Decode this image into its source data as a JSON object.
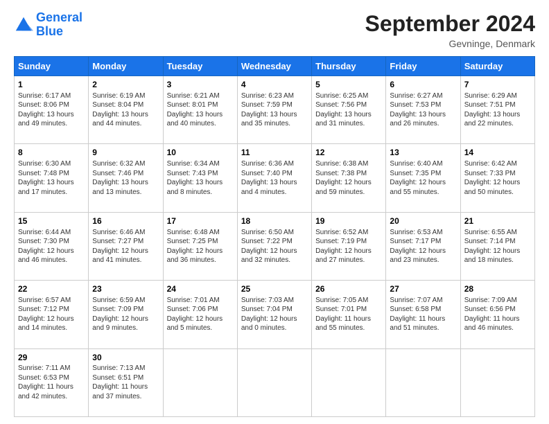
{
  "header": {
    "logo_line1": "General",
    "logo_line2": "Blue",
    "month_title": "September 2024",
    "location": "Gevninge, Denmark"
  },
  "days_of_week": [
    "Sunday",
    "Monday",
    "Tuesday",
    "Wednesday",
    "Thursday",
    "Friday",
    "Saturday"
  ],
  "weeks": [
    [
      {
        "day": "1",
        "sunrise": "Sunrise: 6:17 AM",
        "sunset": "Sunset: 8:06 PM",
        "daylight": "Daylight: 13 hours and 49 minutes."
      },
      {
        "day": "2",
        "sunrise": "Sunrise: 6:19 AM",
        "sunset": "Sunset: 8:04 PM",
        "daylight": "Daylight: 13 hours and 44 minutes."
      },
      {
        "day": "3",
        "sunrise": "Sunrise: 6:21 AM",
        "sunset": "Sunset: 8:01 PM",
        "daylight": "Daylight: 13 hours and 40 minutes."
      },
      {
        "day": "4",
        "sunrise": "Sunrise: 6:23 AM",
        "sunset": "Sunset: 7:59 PM",
        "daylight": "Daylight: 13 hours and 35 minutes."
      },
      {
        "day": "5",
        "sunrise": "Sunrise: 6:25 AM",
        "sunset": "Sunset: 7:56 PM",
        "daylight": "Daylight: 13 hours and 31 minutes."
      },
      {
        "day": "6",
        "sunrise": "Sunrise: 6:27 AM",
        "sunset": "Sunset: 7:53 PM",
        "daylight": "Daylight: 13 hours and 26 minutes."
      },
      {
        "day": "7",
        "sunrise": "Sunrise: 6:29 AM",
        "sunset": "Sunset: 7:51 PM",
        "daylight": "Daylight: 13 hours and 22 minutes."
      }
    ],
    [
      {
        "day": "8",
        "sunrise": "Sunrise: 6:30 AM",
        "sunset": "Sunset: 7:48 PM",
        "daylight": "Daylight: 13 hours and 17 minutes."
      },
      {
        "day": "9",
        "sunrise": "Sunrise: 6:32 AM",
        "sunset": "Sunset: 7:46 PM",
        "daylight": "Daylight: 13 hours and 13 minutes."
      },
      {
        "day": "10",
        "sunrise": "Sunrise: 6:34 AM",
        "sunset": "Sunset: 7:43 PM",
        "daylight": "Daylight: 13 hours and 8 minutes."
      },
      {
        "day": "11",
        "sunrise": "Sunrise: 6:36 AM",
        "sunset": "Sunset: 7:40 PM",
        "daylight": "Daylight: 13 hours and 4 minutes."
      },
      {
        "day": "12",
        "sunrise": "Sunrise: 6:38 AM",
        "sunset": "Sunset: 7:38 PM",
        "daylight": "Daylight: 12 hours and 59 minutes."
      },
      {
        "day": "13",
        "sunrise": "Sunrise: 6:40 AM",
        "sunset": "Sunset: 7:35 PM",
        "daylight": "Daylight: 12 hours and 55 minutes."
      },
      {
        "day": "14",
        "sunrise": "Sunrise: 6:42 AM",
        "sunset": "Sunset: 7:33 PM",
        "daylight": "Daylight: 12 hours and 50 minutes."
      }
    ],
    [
      {
        "day": "15",
        "sunrise": "Sunrise: 6:44 AM",
        "sunset": "Sunset: 7:30 PM",
        "daylight": "Daylight: 12 hours and 46 minutes."
      },
      {
        "day": "16",
        "sunrise": "Sunrise: 6:46 AM",
        "sunset": "Sunset: 7:27 PM",
        "daylight": "Daylight: 12 hours and 41 minutes."
      },
      {
        "day": "17",
        "sunrise": "Sunrise: 6:48 AM",
        "sunset": "Sunset: 7:25 PM",
        "daylight": "Daylight: 12 hours and 36 minutes."
      },
      {
        "day": "18",
        "sunrise": "Sunrise: 6:50 AM",
        "sunset": "Sunset: 7:22 PM",
        "daylight": "Daylight: 12 hours and 32 minutes."
      },
      {
        "day": "19",
        "sunrise": "Sunrise: 6:52 AM",
        "sunset": "Sunset: 7:19 PM",
        "daylight": "Daylight: 12 hours and 27 minutes."
      },
      {
        "day": "20",
        "sunrise": "Sunrise: 6:53 AM",
        "sunset": "Sunset: 7:17 PM",
        "daylight": "Daylight: 12 hours and 23 minutes."
      },
      {
        "day": "21",
        "sunrise": "Sunrise: 6:55 AM",
        "sunset": "Sunset: 7:14 PM",
        "daylight": "Daylight: 12 hours and 18 minutes."
      }
    ],
    [
      {
        "day": "22",
        "sunrise": "Sunrise: 6:57 AM",
        "sunset": "Sunset: 7:12 PM",
        "daylight": "Daylight: 12 hours and 14 minutes."
      },
      {
        "day": "23",
        "sunrise": "Sunrise: 6:59 AM",
        "sunset": "Sunset: 7:09 PM",
        "daylight": "Daylight: 12 hours and 9 minutes."
      },
      {
        "day": "24",
        "sunrise": "Sunrise: 7:01 AM",
        "sunset": "Sunset: 7:06 PM",
        "daylight": "Daylight: 12 hours and 5 minutes."
      },
      {
        "day": "25",
        "sunrise": "Sunrise: 7:03 AM",
        "sunset": "Sunset: 7:04 PM",
        "daylight": "Daylight: 12 hours and 0 minutes."
      },
      {
        "day": "26",
        "sunrise": "Sunrise: 7:05 AM",
        "sunset": "Sunset: 7:01 PM",
        "daylight": "Daylight: 11 hours and 55 minutes."
      },
      {
        "day": "27",
        "sunrise": "Sunrise: 7:07 AM",
        "sunset": "Sunset: 6:58 PM",
        "daylight": "Daylight: 11 hours and 51 minutes."
      },
      {
        "day": "28",
        "sunrise": "Sunrise: 7:09 AM",
        "sunset": "Sunset: 6:56 PM",
        "daylight": "Daylight: 11 hours and 46 minutes."
      }
    ],
    [
      {
        "day": "29",
        "sunrise": "Sunrise: 7:11 AM",
        "sunset": "Sunset: 6:53 PM",
        "daylight": "Daylight: 11 hours and 42 minutes."
      },
      {
        "day": "30",
        "sunrise": "Sunrise: 7:13 AM",
        "sunset": "Sunset: 6:51 PM",
        "daylight": "Daylight: 11 hours and 37 minutes."
      },
      null,
      null,
      null,
      null,
      null
    ]
  ]
}
